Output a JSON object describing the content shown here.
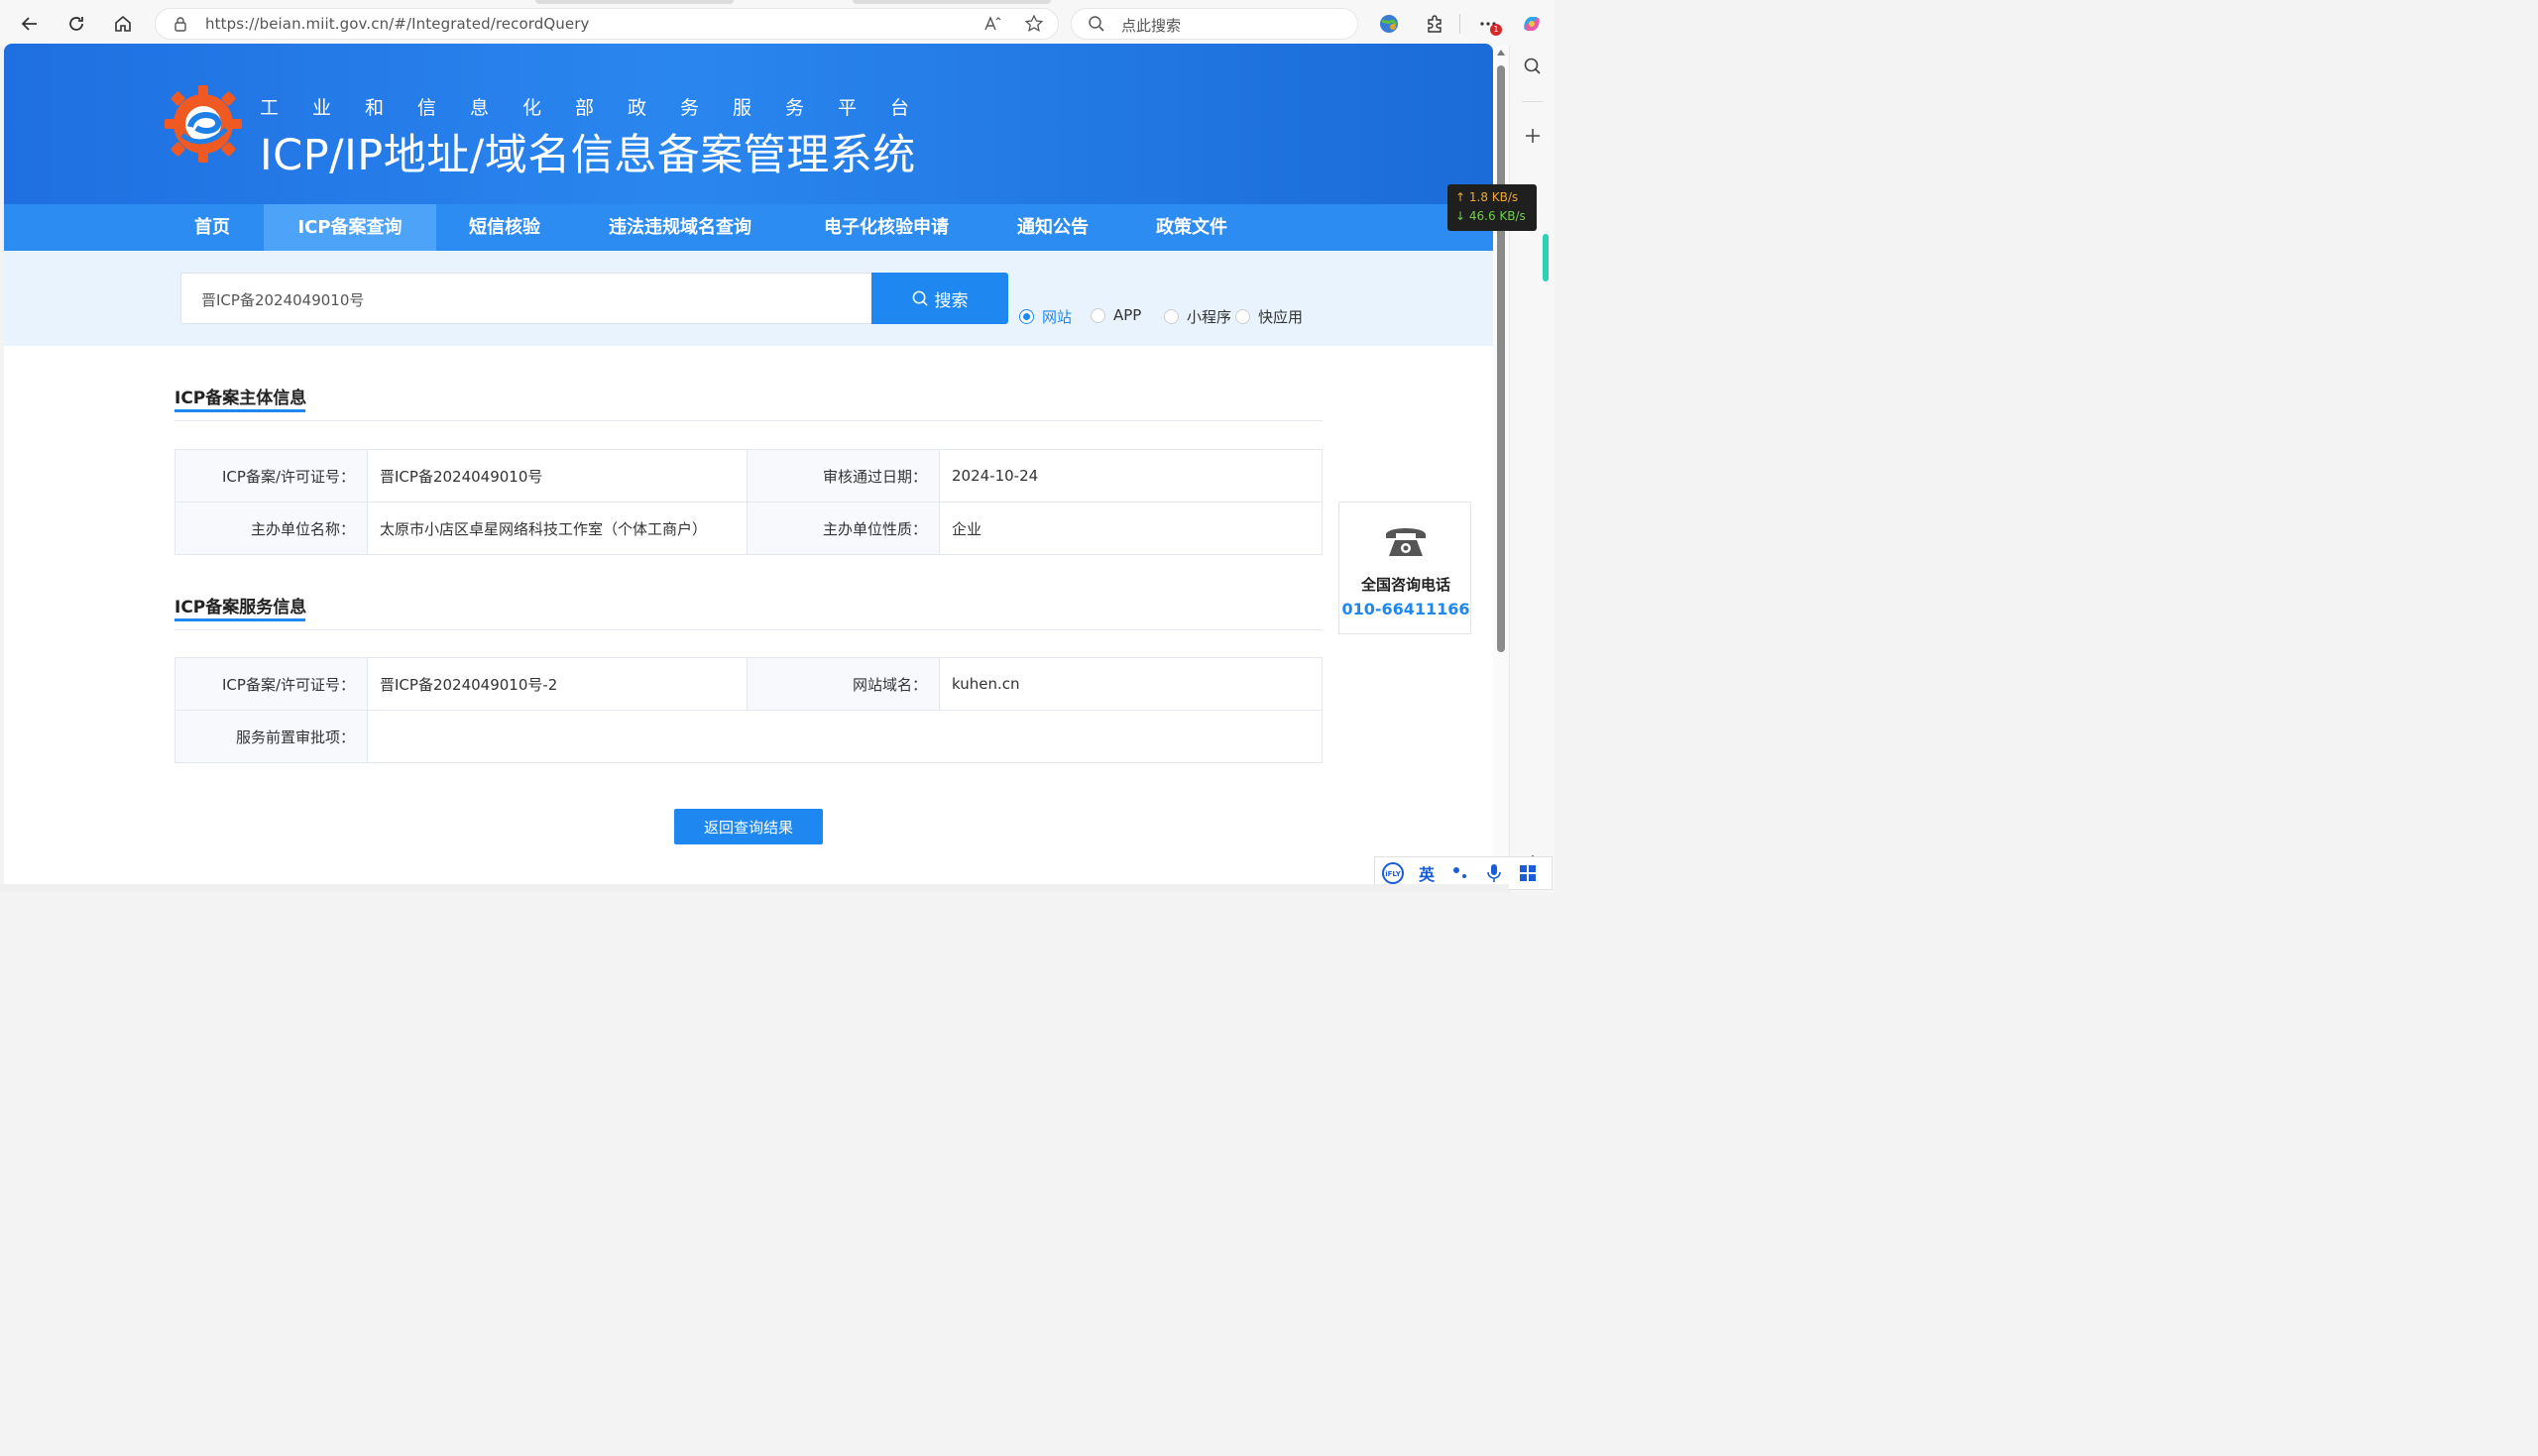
{
  "browser": {
    "url": "https://beian.miit.gov.cn/#/Integrated/recordQuery",
    "search_placeholder": "点此搜索",
    "badge_count": "1"
  },
  "speed": {
    "up": "↑ 1.8 KB/s",
    "down": "↓ 46.6 KB/s"
  },
  "header": {
    "subtitle": "工业和信息化部政务服务平台",
    "title": "ICP/IP地址/域名信息备案管理系统"
  },
  "nav": {
    "items": [
      {
        "label": "首页"
      },
      {
        "label": "ICP备案查询"
      },
      {
        "label": "短信核验"
      },
      {
        "label": "违法违规域名查询"
      },
      {
        "label": "电子化核验申请"
      },
      {
        "label": "通知公告"
      },
      {
        "label": "政策文件"
      }
    ],
    "active_index": 1
  },
  "search": {
    "value": "晋ICP备2024049010号",
    "button_label": "搜索",
    "options": [
      {
        "label": "网站",
        "selected": true
      },
      {
        "label": "APP",
        "selected": false
      },
      {
        "label": "小程序",
        "selected": false
      },
      {
        "label": "快应用",
        "selected": false
      }
    ]
  },
  "subject": {
    "title": "ICP备案主体信息",
    "rows": [
      {
        "l1": "ICP备案/许可证号：",
        "v1": "晋ICP备2024049010号",
        "l2": "审核通过日期：",
        "v2": "2024-10-24"
      },
      {
        "l1": "主办单位名称：",
        "v1": "太原市小店区卓星网络科技工作室（个体工商户）",
        "l2": "主办单位性质：",
        "v2": "企业"
      }
    ]
  },
  "service": {
    "title": "ICP备案服务信息",
    "license_label": "ICP备案/许可证号：",
    "license_value": "晋ICP备2024049010号-2",
    "domain_label": "网站域名：",
    "domain_value": "kuhen.cn",
    "approval_label": "服务前置审批项：",
    "approval_value": ""
  },
  "back_button": "返回查询结果",
  "hotline": {
    "label": "全国咨询电话",
    "number": "010-66411166"
  },
  "ifly": {
    "lang": "英"
  },
  "colors": {
    "primary": "#1e88f0",
    "header_dark": "#1f6fe0",
    "nav": "#2c8cf2",
    "logo_orange": "#f05a22"
  }
}
